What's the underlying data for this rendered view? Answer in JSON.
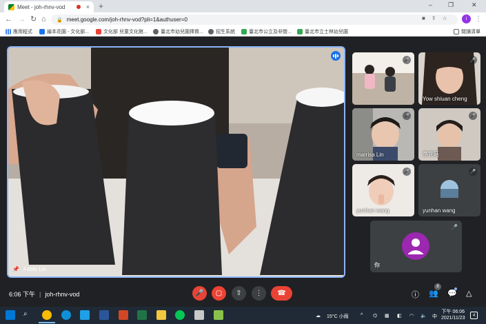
{
  "browser": {
    "tab_title": "Meet - joh-rhnv-vod",
    "tab_close": "×",
    "new_tab": "+",
    "window_controls": [
      "–",
      "❐",
      "✕"
    ],
    "url": "meet.google.com/joh-rhnv-vod?pli=1&authuser=0",
    "profile_initial": "i",
    "menu": "⋮"
  },
  "bookmarks": [
    {
      "label": "應用程式",
      "color": "#4285f4"
    },
    {
      "label": "繪本花園 - 文化部...",
      "color": "#1a73e8"
    },
    {
      "label": "文化部 兒童文化館...",
      "color": "#ea4335"
    },
    {
      "label": "臺北市幼兒園擇資...",
      "color": "#5f6368"
    },
    {
      "label": "招生系統",
      "color": "#5f6368"
    },
    {
      "label": "臺北市公立及非營...",
      "color": "#34a853"
    },
    {
      "label": "臺北市立士林幼兒園",
      "color": "#34a853"
    }
  ],
  "reading_list": "閱讀清單",
  "main_participant": {
    "name": "Feble Lin"
  },
  "participants": [
    {
      "name": "",
      "muted": true
    },
    {
      "name": "Yow shiuan cheng",
      "muted": true
    },
    {
      "name": "marrisa Lin",
      "muted": true
    },
    {
      "name": "李宜廷",
      "muted": true
    },
    {
      "name": "yunhan wang",
      "muted": true
    },
    {
      "name": "yunhan wang",
      "muted": true
    }
  ],
  "self_tile": {
    "name": "你",
    "avatar_color": "#9c27b0"
  },
  "meeting": {
    "time": "6:06 下午",
    "code": "joh-rhnv-vod",
    "participant_count": "8"
  },
  "taskbar": {
    "weather": "15°C 小雨",
    "ime": "中",
    "time": "下午 06:06",
    "date": "2021/11/23",
    "notifications": "4"
  }
}
